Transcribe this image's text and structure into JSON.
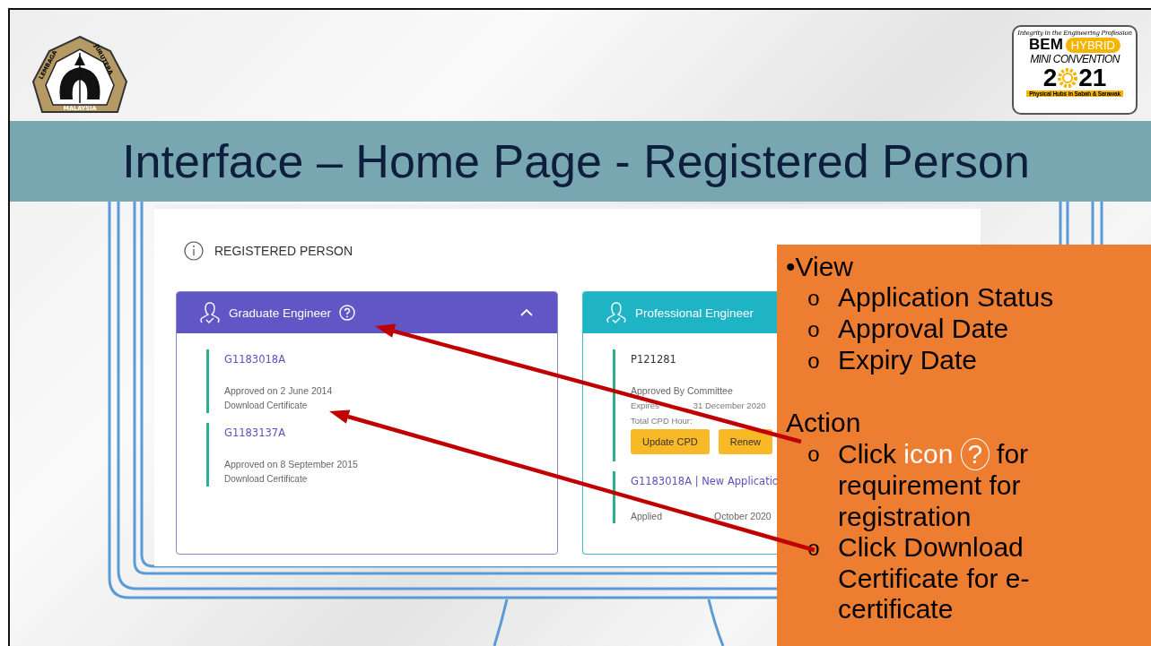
{
  "logos": {
    "left": {
      "top_left": "LEMBAGA",
      "top_right": "JURUTERA",
      "bottom": "MALAYSIA"
    },
    "right": {
      "tagline": "Integrity in the Engineering Profession",
      "brand": "BEM",
      "badge": "HYBRID",
      "subtitle": "MINI CONVENTION",
      "year_start": "2",
      "year_end": "21",
      "footer": "Physical Hubs in Sabah & Sarawak"
    }
  },
  "title": "Interface – Home Page - Registered Person",
  "screen": {
    "section_title": "REGISTERED PERSON",
    "cards": [
      {
        "kind": "graduate",
        "title": "Graduate Engineer",
        "help": true,
        "expanded": true,
        "entries": [
          {
            "id": "G1183018A",
            "kind": "link",
            "lines": [
              {
                "kind": "status",
                "parts": [
                  "Approved on 2 June 2014"
                ]
              },
              {
                "kind": "action",
                "parts": [
                  "Download Certificate"
                ]
              }
            ]
          },
          {
            "id": "G1183137A",
            "kind": "link",
            "lines": [
              {
                "kind": "status",
                "parts": [
                  "Approved on 8 September 2015"
                ]
              },
              {
                "kind": "action",
                "parts": [
                  "Download Certificate"
                ]
              }
            ]
          }
        ]
      },
      {
        "kind": "professional",
        "title": "Professional Engineer",
        "help": false,
        "entries": [
          {
            "id": "P121281",
            "kind": "plain",
            "lines": [
              {
                "kind": "status",
                "parts": [
                  "Approved By Committee"
                ]
              },
              {
                "kind": "detail",
                "parts": [
                  "Expires",
                  "31 December 2020"
                ]
              },
              {
                "kind": "detail",
                "parts": [
                  "Total CPD Hour:"
                ]
              }
            ],
            "buttons": [
              "Update CPD",
              "Renew"
            ]
          },
          {
            "id": "G1183018A | New Applicatio",
            "kind": "link",
            "lines": [
              {
                "kind": "gap"
              },
              {
                "kind": "status",
                "parts": [
                  "Applied",
                  "October 2020"
                ]
              }
            ]
          }
        ]
      }
    ]
  },
  "callout": {
    "sections": [
      {
        "heading": "•View",
        "items": [
          {
            "bullet": "o",
            "parts": [
              {
                "kind": "text",
                "text": "Application Status"
              }
            ]
          },
          {
            "bullet": "o",
            "parts": [
              {
                "kind": "text",
                "text": "Approval Date"
              }
            ]
          },
          {
            "bullet": "o",
            "parts": [
              {
                "kind": "text",
                "text": "Expiry Date"
              }
            ]
          }
        ]
      },
      {
        "heading": "Action",
        "items": [
          {
            "bullet": "o",
            "parts": [
              {
                "kind": "text",
                "text": "Click"
              },
              {
                "kind": "highlight",
                "text": "icon"
              },
              {
                "kind": "circled",
                "text": "?"
              },
              {
                "kind": "text",
                "text": "for requirement for registration"
              }
            ]
          },
          {
            "bullet": "o",
            "parts": [
              {
                "kind": "text",
                "text": "Click Download Certificate for e-certificate"
              }
            ]
          }
        ]
      }
    ]
  }
}
